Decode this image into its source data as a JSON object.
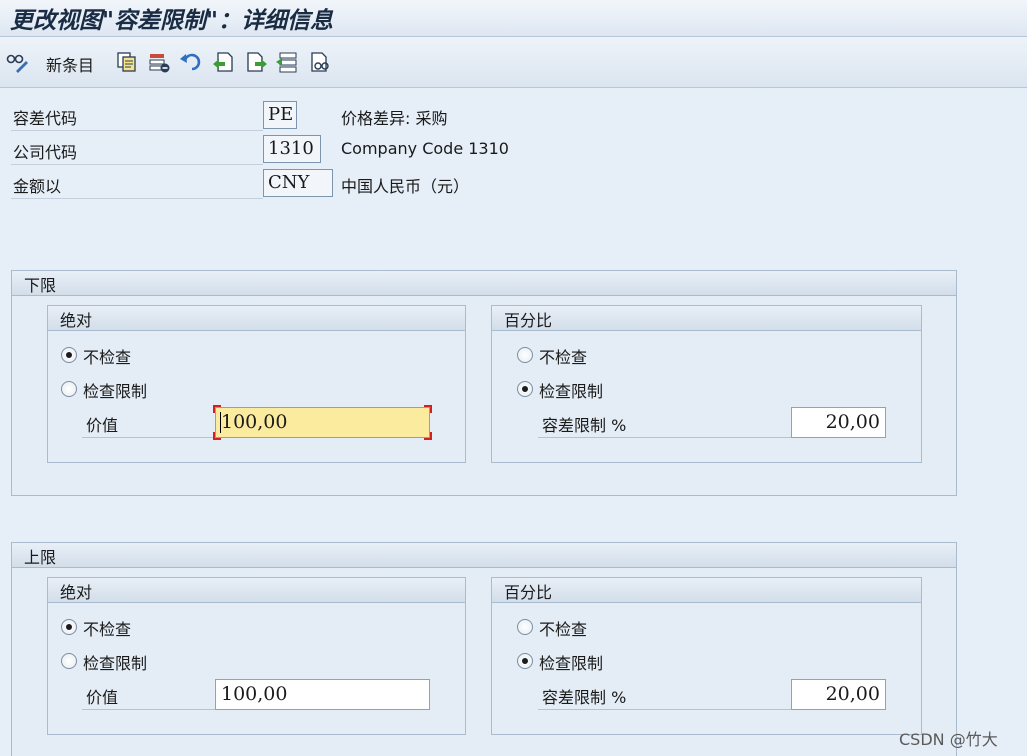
{
  "window": {
    "title": "更改视图\"容差限制\"：详细信息"
  },
  "toolbar": {
    "new_entries_label": "新条目",
    "icons": [
      "glasses-pen-icon",
      "copy-icon",
      "delete-icon",
      "undo-icon",
      "previous-entry-icon",
      "next-entry-icon",
      "select-all-icon",
      "other-entry-icon"
    ]
  },
  "header": {
    "tolerance_key": {
      "label": "容差代码",
      "value": "PE",
      "description": "价格差异: 采购"
    },
    "company_code": {
      "label": "公司代码",
      "value": "1310",
      "description": "Company Code 1310"
    },
    "amount_in": {
      "label": "金额以",
      "value": "CNY",
      "description": "中国人民币（元）"
    }
  },
  "lower_limit": {
    "title": "下限",
    "absolute": {
      "title": "绝对",
      "option_no_check": "不检查",
      "option_check_limit": "检查限制",
      "selected": "no_check",
      "value_label": "价值",
      "value": "100,00"
    },
    "percentage": {
      "title": "百分比",
      "option_no_check": "不检查",
      "option_check_limit": "检查限制",
      "selected": "check_limit",
      "value_label": "容差限制 %",
      "value": "20,00"
    }
  },
  "upper_limit": {
    "title": "上限",
    "absolute": {
      "title": "绝对",
      "option_no_check": "不检查",
      "option_check_limit": "检查限制",
      "selected": "no_check",
      "value_label": "价值",
      "value": "100,00"
    },
    "percentage": {
      "title": "百分比",
      "option_no_check": "不检查",
      "option_check_limit": "检查限制",
      "selected": "check_limit",
      "value_label": "容差限制 %",
      "value": "20,00"
    }
  },
  "watermark": "CSDN @竹大"
}
